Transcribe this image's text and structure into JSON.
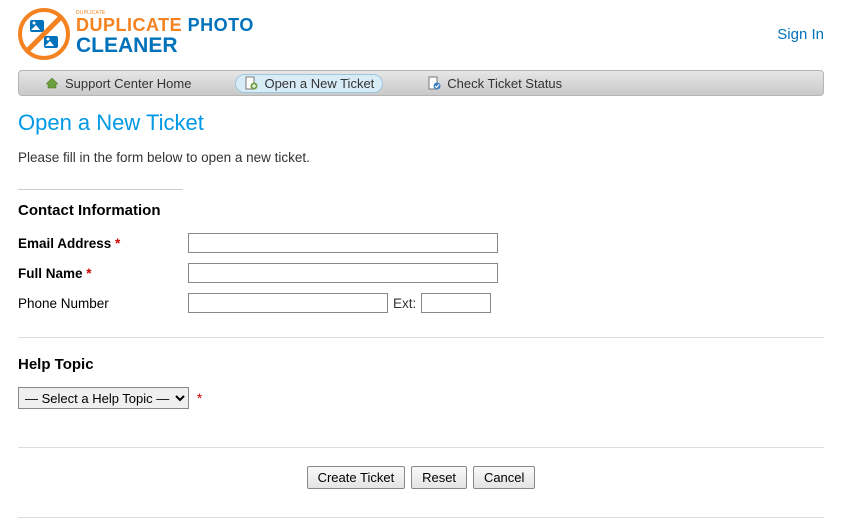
{
  "header": {
    "signin": "Sign In",
    "brand_top_tiny": "DUPLICATE",
    "brand_dup": "DUPLICATE ",
    "brand_photo": "PHOTO",
    "brand_cleaner": "CLEANER"
  },
  "nav": {
    "home": "Support Center Home",
    "new": "Open a New Ticket",
    "status": "Check Ticket Status"
  },
  "page": {
    "title": "Open a New Ticket",
    "instructions": "Please fill in the form below to open a new ticket.",
    "contact_heading": "Contact Information",
    "email_label": "Email Address ",
    "name_label": "Full Name ",
    "phone_label": "Phone Number",
    "ext_label": "Ext:",
    "help_heading": "Help Topic",
    "help_option": "— Select a Help Topic —",
    "required": "*",
    "email_value": "",
    "name_value": "",
    "phone_value": "",
    "ext_value": ""
  },
  "buttons": {
    "create": "Create Ticket",
    "reset": "Reset",
    "cancel": "Cancel"
  }
}
